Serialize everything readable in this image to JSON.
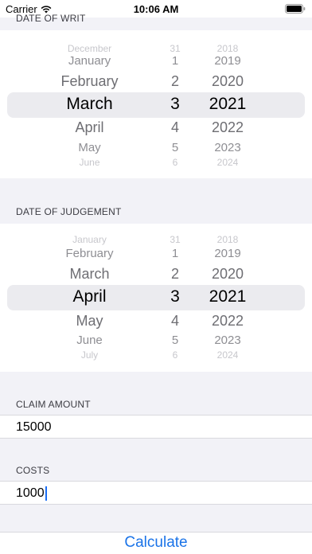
{
  "status_bar": {
    "carrier": "Carrier",
    "time": "10:06 AM"
  },
  "date_of_writ": {
    "header": "DATE OF WRIT",
    "rows": [
      {
        "month": "December",
        "day": "31",
        "year": "2018"
      },
      {
        "month": "January",
        "day": "1",
        "year": "2019"
      },
      {
        "month": "February",
        "day": "2",
        "year": "2020"
      },
      {
        "month": "March",
        "day": "3",
        "year": "2021"
      },
      {
        "month": "April",
        "day": "4",
        "year": "2022"
      },
      {
        "month": "May",
        "day": "5",
        "year": "2023"
      },
      {
        "month": "June",
        "day": "6",
        "year": "2024"
      }
    ],
    "selected": {
      "month": "March",
      "day": "3",
      "year": "2021"
    }
  },
  "date_of_judgement": {
    "header": "DATE OF JUDGEMENT",
    "rows": [
      {
        "month": "January",
        "day": "31",
        "year": "2018"
      },
      {
        "month": "February",
        "day": "1",
        "year": "2019"
      },
      {
        "month": "March",
        "day": "2",
        "year": "2020"
      },
      {
        "month": "April",
        "day": "3",
        "year": "2021"
      },
      {
        "month": "May",
        "day": "4",
        "year": "2022"
      },
      {
        "month": "June",
        "day": "5",
        "year": "2023"
      },
      {
        "month": "July",
        "day": "6",
        "year": "2024"
      }
    ],
    "selected": {
      "month": "April",
      "day": "3",
      "year": "2021"
    }
  },
  "claim_amount": {
    "header": "CLAIM AMOUNT",
    "value": "15000"
  },
  "costs": {
    "header": "COSTS",
    "value": "1000"
  },
  "calculate_label": "Calculate"
}
